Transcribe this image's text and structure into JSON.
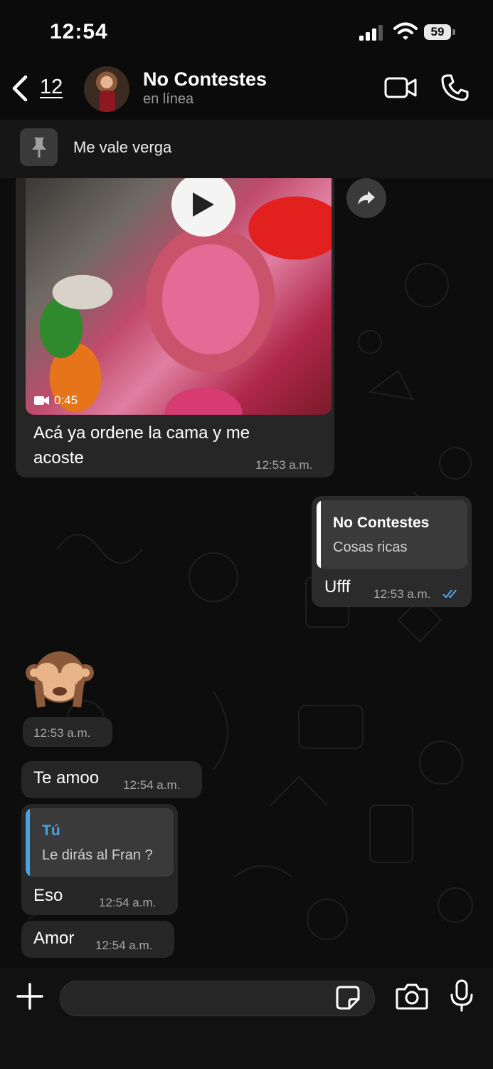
{
  "status_bar": {
    "time": "12:54",
    "battery": "59"
  },
  "header": {
    "back_count": "12",
    "contact_name": "No Contestes",
    "contact_status": "en línea",
    "icons": [
      "chevron-left-icon",
      "video-camera-icon",
      "phone-icon"
    ]
  },
  "pinned": {
    "text": "Me vale verga",
    "icon": "pin-icon"
  },
  "messages": [
    {
      "direction": "in",
      "type": "video",
      "duration": "0:45",
      "caption_line1": "Acá ya ordene la cama y me",
      "caption_line2": "acoste",
      "time": "12:53 a.m."
    },
    {
      "direction": "out",
      "quote_author": "No Contestes",
      "quote_text": "Cosas ricas",
      "text": "Ufff",
      "time": "12:53 a.m.",
      "read_status": "double-check"
    },
    {
      "direction": "in",
      "type": "emoji",
      "emoji": "see-no-evil-monkey",
      "time": "12:53 a.m."
    },
    {
      "direction": "in",
      "text": "Te amoo",
      "time": "12:54 a.m."
    },
    {
      "direction": "in",
      "quote_author": "Tú",
      "quote_text": "Le dirás al Fran ?",
      "text": "Eso",
      "time": "12:54 a.m."
    },
    {
      "direction": "in",
      "text": "Amor",
      "time": "12:54 a.m."
    }
  ],
  "input_bar": {
    "icons": [
      "plus-icon",
      "sticker-icon",
      "camera-icon",
      "microphone-icon"
    ]
  },
  "colors": {
    "quote_bar_out": "#ffffff",
    "quote_bar_in": "#4aa3df",
    "quote_author_in": "#4aa3df",
    "read_ticks": "#53a6e8"
  }
}
